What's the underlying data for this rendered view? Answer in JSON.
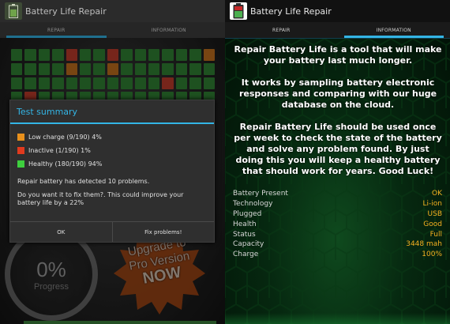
{
  "left": {
    "app_title": "Battery Life Repair",
    "tabs": [
      {
        "label": "REPAIR",
        "selected": true
      },
      {
        "label": "INFORMATION",
        "selected": false
      }
    ],
    "grid": {
      "columns": 15,
      "rows": 4,
      "red_cells": [
        4,
        7,
        41,
        46
      ],
      "orange_cells": [
        14,
        19,
        22
      ],
      "colors": {
        "healthy": "#2e7d32",
        "inactive": "#b53a2a",
        "low_charge": "#b86a1c"
      }
    },
    "progress": {
      "value": "0%",
      "label": "Progress"
    },
    "promo": {
      "line1": "Upgrade to",
      "line2": "Pro Version",
      "line3": "NOW"
    },
    "dialog": {
      "title": "Test summary",
      "stats": [
        {
          "label": "Low charge (9/190)  4%",
          "color": "#e8901c"
        },
        {
          "label": "Inactive (1/190)  1%",
          "color": "#e03a1e"
        },
        {
          "label": "Healthy (180/190)  94%",
          "color": "#3ecf3e"
        }
      ],
      "message": "Repair battery has detected 10 problems.",
      "question": "Do you want it to fix them?. This could improve your battery life by a 22%",
      "ok_label": "OK",
      "fix_label": "Fix problems!"
    }
  },
  "right": {
    "app_title": "Battery Life Repair",
    "tabs": [
      {
        "label": "REPAIR",
        "selected": false
      },
      {
        "label": "INFORMATION",
        "selected": true
      }
    ],
    "paragraphs": [
      "Repair Battery Life is a tool that will make your battery last much longer.",
      "It works by sampling battery electronic responses and comparing with our huge database on the cloud.",
      "Repair Battery Life should be used once per week to check the state of the battery and solve any problem found. By just doing this you will keep a healthy battery that should work for years. Good Luck!"
    ],
    "properties": [
      {
        "label": "Battery Present",
        "value": "OK"
      },
      {
        "label": "Technology",
        "value": "Li-ion"
      },
      {
        "label": "Plugged",
        "value": "USB"
      },
      {
        "label": "Health",
        "value": "Good"
      },
      {
        "label": "Status",
        "value": "Full"
      },
      {
        "label": "Capacity",
        "value": "3448 mah"
      },
      {
        "label": "Charge",
        "value": "100%"
      }
    ]
  },
  "colors": {
    "accent": "#33b5e5",
    "value_text": "#f5b020"
  }
}
